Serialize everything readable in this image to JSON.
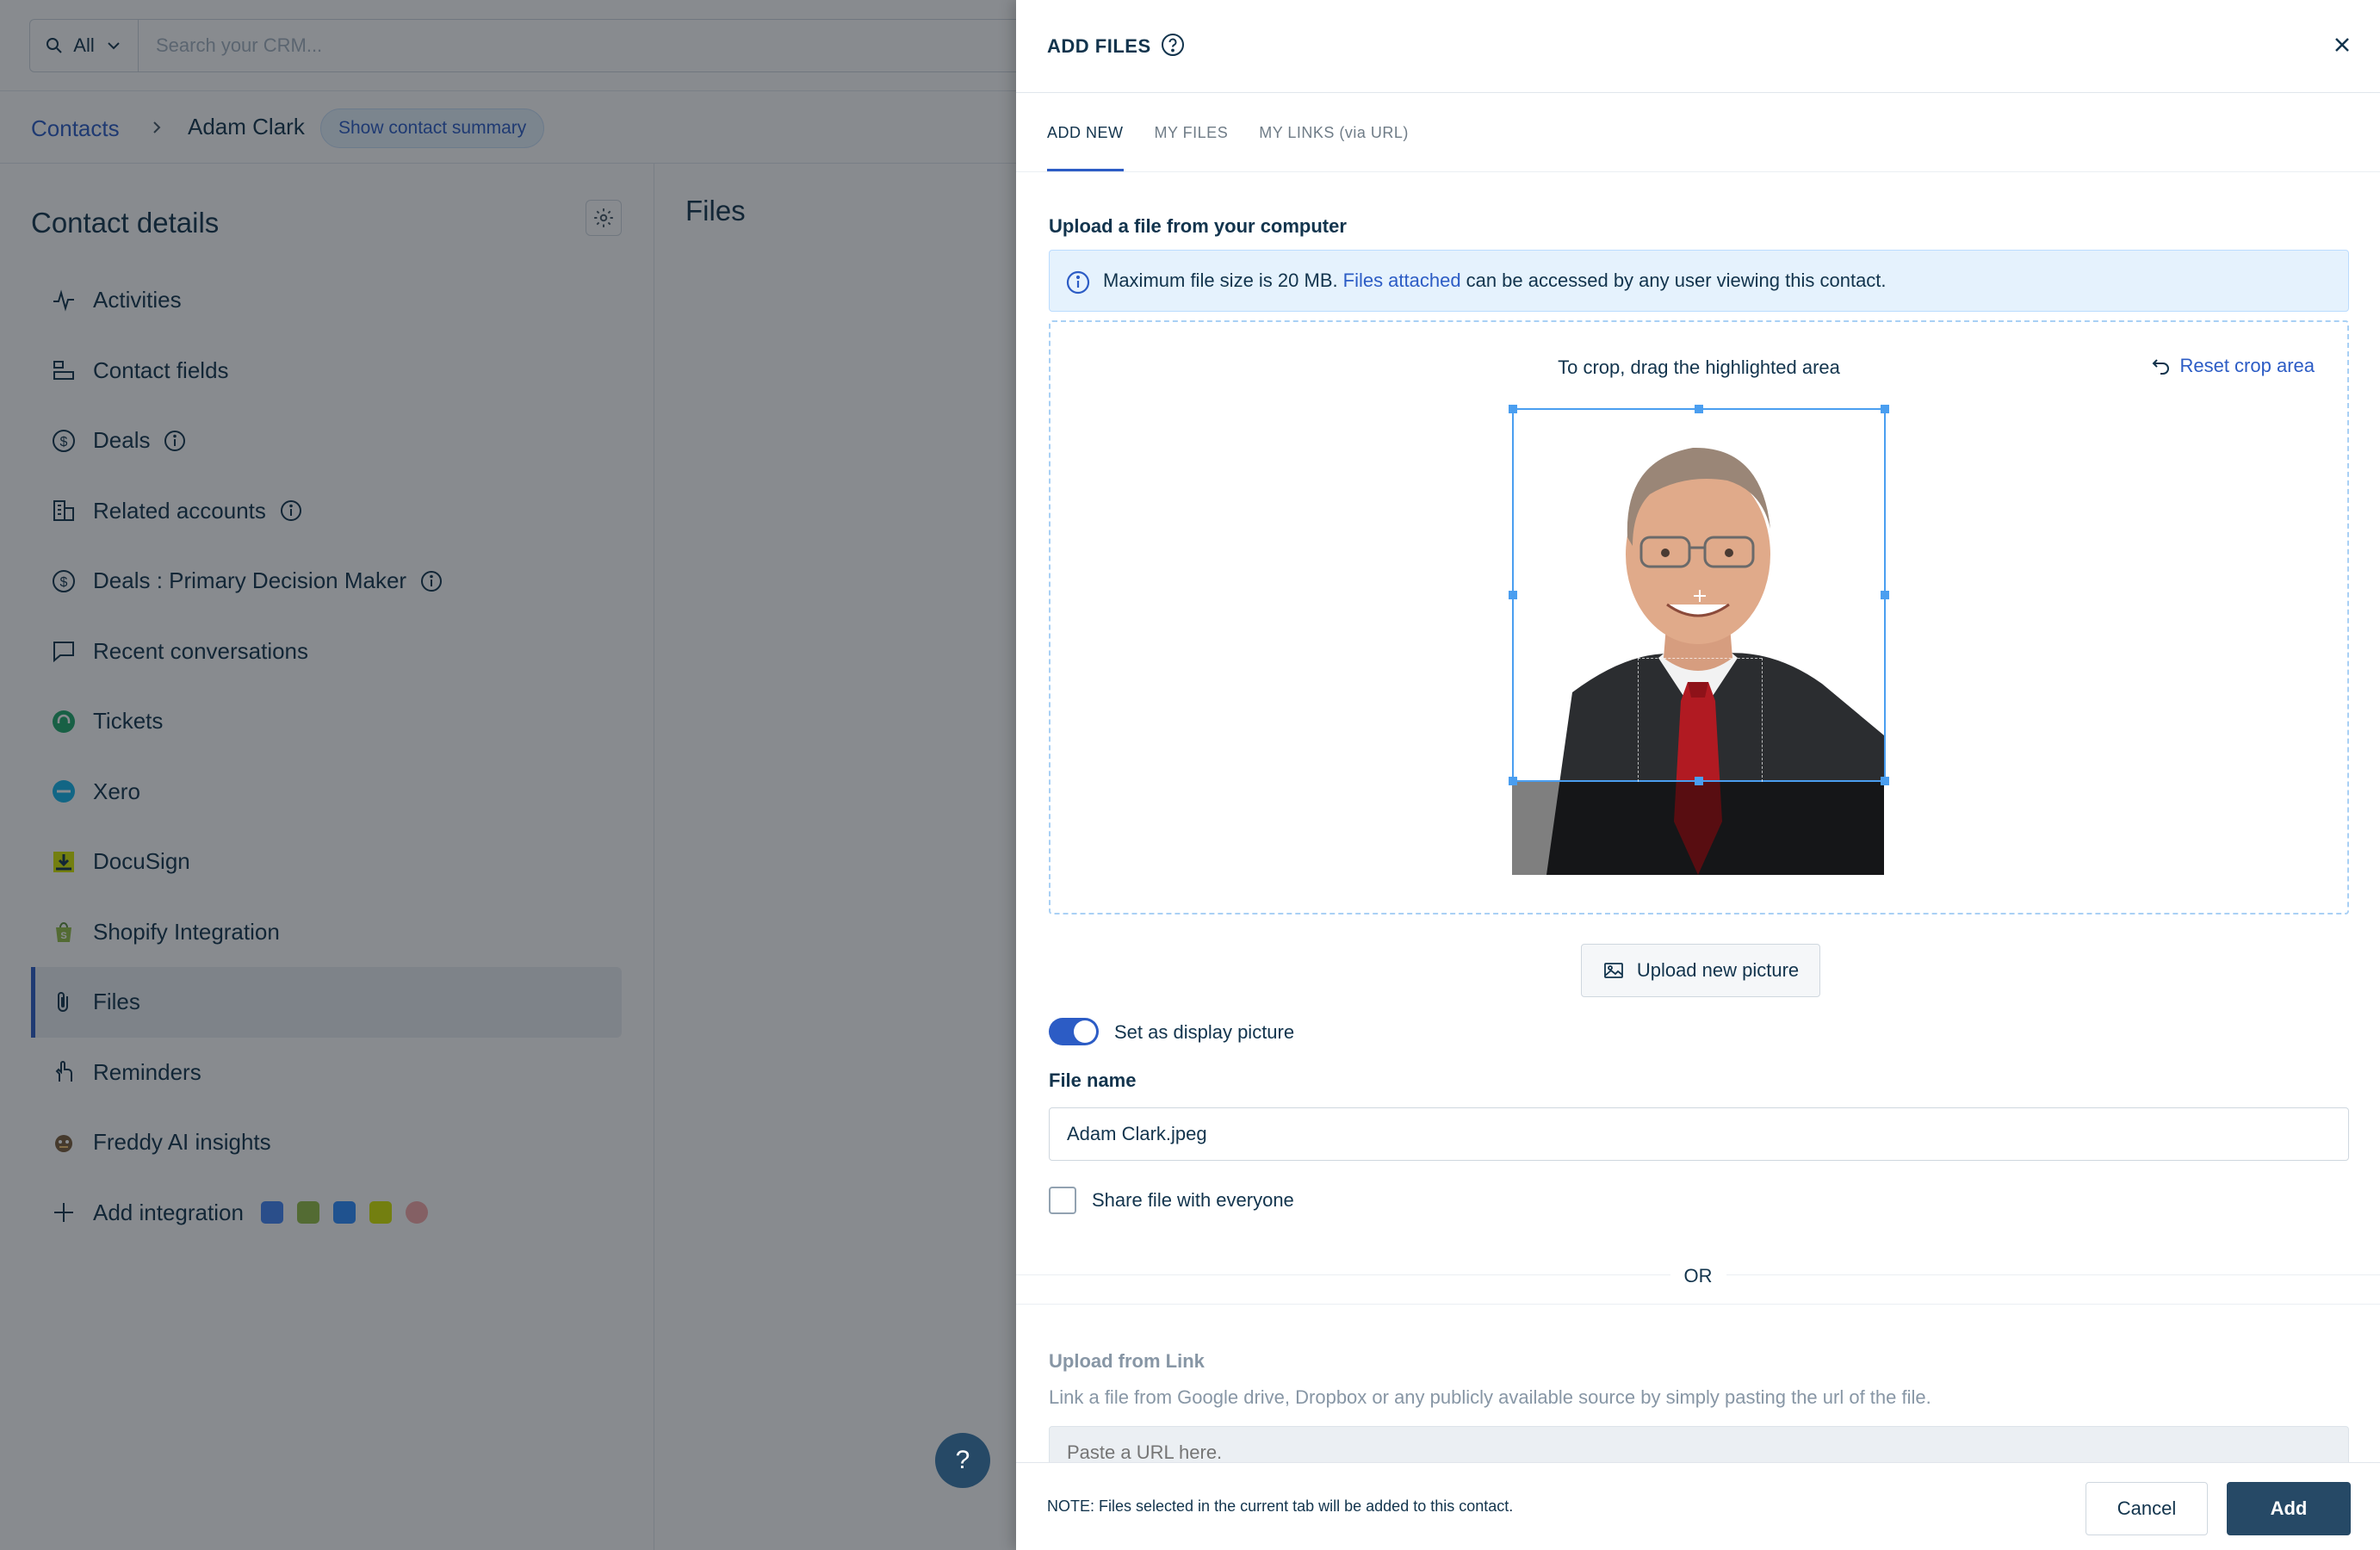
{
  "search": {
    "scope": "All",
    "placeholder": "Search your CRM..."
  },
  "breadcrumb": {
    "parent": "Contacts",
    "current": "Adam Clark",
    "summary_button": "Show contact summary"
  },
  "left_panel": {
    "title": "Contact details",
    "items": [
      {
        "label": "Activities",
        "icon": "activity-icon"
      },
      {
        "label": "Contact fields",
        "icon": "fields-icon"
      },
      {
        "label": "Deals",
        "icon": "dollar-icon",
        "info": true
      },
      {
        "label": "Related accounts",
        "icon": "building-icon",
        "info": true
      },
      {
        "label": "Deals : Primary Decision Maker",
        "icon": "dollar-icon",
        "info": true
      },
      {
        "label": "Recent conversations",
        "icon": "chat-icon"
      },
      {
        "label": "Tickets",
        "icon": "headset-icon"
      },
      {
        "label": "Xero",
        "icon": "xero-icon"
      },
      {
        "label": "DocuSign",
        "icon": "docusign-icon"
      },
      {
        "label": "Shopify Integration",
        "icon": "shopify-icon"
      },
      {
        "label": "Files",
        "icon": "paperclip-icon",
        "active": true
      },
      {
        "label": "Reminders",
        "icon": "reminder-icon"
      },
      {
        "label": "Freddy AI insights",
        "icon": "freddy-icon"
      },
      {
        "label": "Add integration",
        "icon": "plus-icon"
      }
    ]
  },
  "main_panel": {
    "title": "Files"
  },
  "drawer": {
    "title": "ADD FILES",
    "tabs": [
      {
        "label": "ADD NEW",
        "active": true
      },
      {
        "label": "MY FILES",
        "active": false
      },
      {
        "label": "MY LINKS (via URL)",
        "active": false
      }
    ],
    "upload_label": "Upload a file from your computer",
    "banner": {
      "before": "Maximum file size is 20 MB.",
      "link": "Files attached",
      "after": "can be accessed by any user viewing this contact."
    },
    "crop_hint": "To crop, drag the highlighted area",
    "reset_crop": "Reset crop area",
    "upload_new": "Upload new picture",
    "display_picture_toggle": {
      "label": "Set as display picture",
      "on": true
    },
    "file_name_label": "File name",
    "file_name_value": "Adam Clark.jpeg",
    "share_checkbox": {
      "label": "Share file with everyone",
      "checked": false
    },
    "or_text": "OR",
    "link_section": {
      "label": "Upload from Link",
      "description": "Link a file from Google drive, Dropbox or any publicly available source by simply pasting the url of the file.",
      "placeholder": "Paste a URL here."
    },
    "footer": {
      "note": "NOTE: Files selected in the current tab will be added to this contact.",
      "cancel": "Cancel",
      "add": "Add"
    }
  },
  "colors": {
    "accent": "#2c5cc5",
    "primary_button": "#264966",
    "banner_bg": "#e5f2fd",
    "crop_border": "#4a9ef0"
  }
}
